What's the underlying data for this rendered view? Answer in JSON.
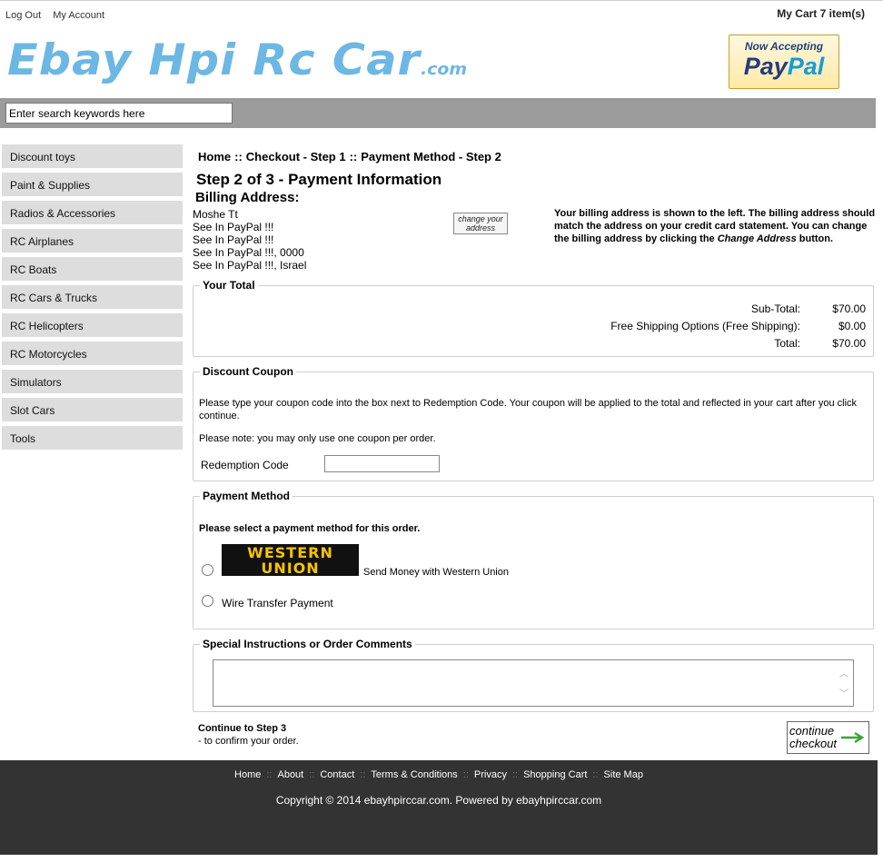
{
  "header": {
    "logout": "Log Out",
    "account": "My Account",
    "cart": "My Cart 7 item(s)",
    "logo_main": "Ebay Hpi Rc Car",
    "logo_suffix": ".com",
    "paypal_top": "Now Accepting",
    "paypal_pay": "Pay",
    "paypal_pal": "Pal"
  },
  "search": {
    "value": "Enter search keywords here"
  },
  "sidebar": {
    "items": [
      {
        "label": "Discount toys"
      },
      {
        "label": "Paint & Supplies"
      },
      {
        "label": "Radios & Accessories"
      },
      {
        "label": "RC Airplanes"
      },
      {
        "label": "RC Boats"
      },
      {
        "label": "RC Cars & Trucks"
      },
      {
        "label": "RC Helicopters"
      },
      {
        "label": "RC Motorcycles"
      },
      {
        "label": "Simulators"
      },
      {
        "label": "Slot Cars"
      },
      {
        "label": "Tools"
      }
    ]
  },
  "breadcrumb": {
    "home": "Home",
    "sep": "::",
    "step1": "Checkout - Step 1",
    "step2": "Payment Method - Step 2"
  },
  "page": {
    "title": "Step 2 of 3 - Payment Information",
    "billing_heading": "Billing Address:"
  },
  "billing": {
    "lines": [
      "Moshe Tt",
      "See In PayPal !!!",
      "See In PayPal !!!",
      "See In PayPal !!!, 0000",
      "See In PayPal !!!, Israel"
    ],
    "change_line1": "change your",
    "change_line2": "address",
    "note_pre": "Your billing address is shown to the left. The billing address should match the address on your credit card statement. You can change the billing address by clicking the ",
    "note_em": "Change Address",
    "note_post": " button."
  },
  "total": {
    "legend": "Your Total",
    "rows": [
      {
        "label": "Sub-Total:",
        "value": "$70.00"
      },
      {
        "label": "Free Shipping Options (Free Shipping):",
        "value": "$0.00"
      },
      {
        "label": "Total:",
        "value": "$70.00"
      }
    ]
  },
  "coupon": {
    "legend": "Discount Coupon",
    "text1": "Please type your coupon code into the box next to Redemption Code. Your coupon will be applied to the total and reflected in your cart after you click continue.",
    "text2": "Please note: you may only use one coupon per order.",
    "code_label": "Redemption Code",
    "code_value": ""
  },
  "payment": {
    "legend": "Payment Method",
    "prompt": "Please select a payment method for this order.",
    "wu_line1": "WESTERN",
    "wu_line2": "UNION",
    "wu_label": "Send Money with Western Union",
    "wire_label": "Wire Transfer Payment"
  },
  "comments": {
    "legend": "Special Instructions or Order Comments",
    "value": ""
  },
  "continue": {
    "title": "Continue to Step 3",
    "subtitle": "- to confirm your order.",
    "btn_line1": "continue",
    "btn_line2": "checkout"
  },
  "footer": {
    "links": [
      "Home",
      "About",
      "Contact",
      "Terms & Conditions",
      "Privacy",
      "Shopping Cart",
      "Site Map"
    ],
    "sep": "::",
    "copyright": "Copyright © 2014 ebayhpirccar.com. Powered by ebayhpirccar.com"
  }
}
